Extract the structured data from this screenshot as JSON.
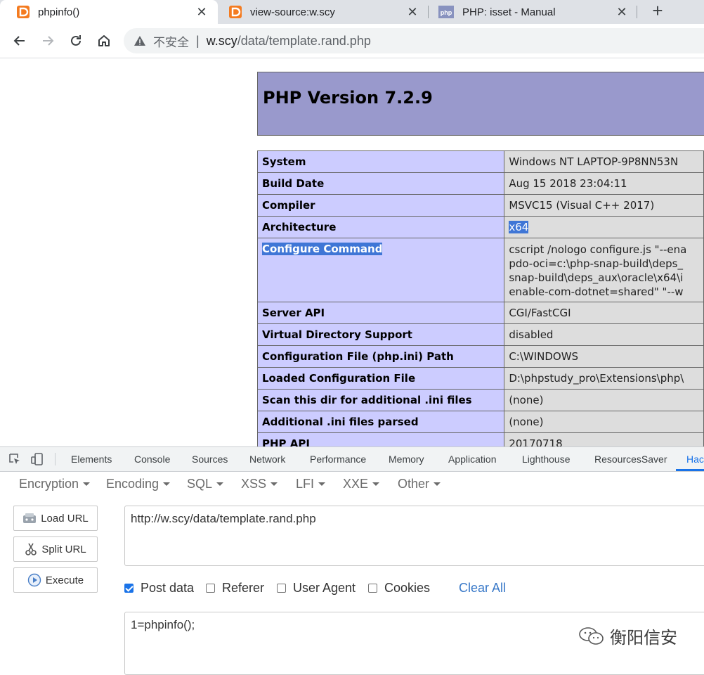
{
  "tabs": [
    {
      "title": "phpinfo()",
      "close": "✕",
      "favicon": "phpstudy-icon",
      "active": true
    },
    {
      "title": "view-source:w.scy",
      "close": "✕",
      "favicon": "phpstudy-icon",
      "active": false
    },
    {
      "title": "PHP: isset - Manual",
      "close": "✕",
      "favicon": "php-icon",
      "active": false
    }
  ],
  "new_tab": "+",
  "toolbar": {
    "security_label": "不安全",
    "separator": "|",
    "url_host": "w.scy",
    "url_path": "/data/template.rand.php"
  },
  "php": {
    "title": "PHP Version 7.2.9",
    "rows": [
      {
        "key": "System",
        "value": "Windows NT LAPTOP-9P8NN53N"
      },
      {
        "key": "Build Date",
        "value": "Aug 15 2018 23:04:11"
      },
      {
        "key": "Compiler",
        "value": "MSVC15 (Visual C++ 2017)"
      },
      {
        "key": "Architecture",
        "value": "x64"
      },
      {
        "key": "Configure Command",
        "value": "cscript /nologo configure.js \"--ena\npdo-oci=c:\\php-snap-build\\deps_\nsnap-build\\deps_aux\\oracle\\x64\\i\nenable-com-dotnet=shared\" \"--w"
      },
      {
        "key": "Server API",
        "value": "CGI/FastCGI"
      },
      {
        "key": "Virtual Directory Support",
        "value": "disabled"
      },
      {
        "key": "Configuration File (php.ini) Path",
        "value": "C:\\WINDOWS"
      },
      {
        "key": "Loaded Configuration File",
        "value": "D:\\phpstudy_pro\\Extensions\\php\\"
      },
      {
        "key": "Scan this dir for additional .ini files",
        "value": "(none)"
      },
      {
        "key": "Additional .ini files parsed",
        "value": "(none)"
      },
      {
        "key": "PHP API",
        "value": "20170718"
      }
    ]
  },
  "devtools": {
    "tabs": [
      "Elements",
      "Console",
      "Sources",
      "Network",
      "Performance",
      "Memory",
      "Application",
      "Lighthouse",
      "ResourcesSaver",
      "Hac"
    ]
  },
  "hackbar": {
    "menu": [
      "Encryption",
      "Encoding",
      "SQL",
      "XSS",
      "LFI",
      "XXE",
      "Other"
    ],
    "load_url": "Load URL",
    "split_url": "Split URL",
    "execute": "Execute",
    "url_value": "http://w.scy/data/template.rand.php",
    "options": [
      {
        "label": "Post data",
        "checked": true
      },
      {
        "label": "Referer",
        "checked": false
      },
      {
        "label": "User Agent",
        "checked": false
      },
      {
        "label": "Cookies",
        "checked": false
      }
    ],
    "clear_all": "Clear All",
    "post_value": "1=phpinfo();"
  },
  "watermark": "衡阳信安",
  "colors": {
    "php_header": "#9999cc",
    "php_key": "#ccccff",
    "php_value": "#dddddd",
    "selection": "#3f76d6",
    "accent": "#1a73e8"
  }
}
